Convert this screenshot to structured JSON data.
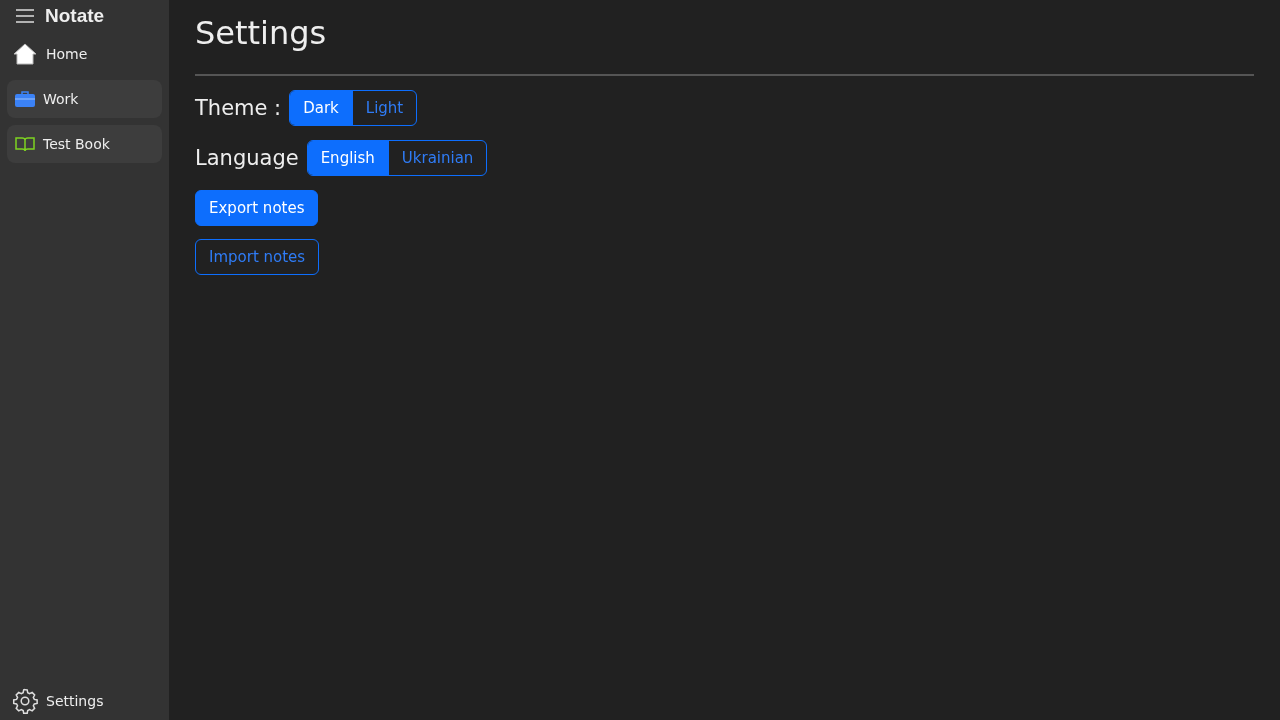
{
  "app": {
    "title": "Notate"
  },
  "sidebar": {
    "items": [
      {
        "label": "Home",
        "kind": "home"
      },
      {
        "label": "Work",
        "kind": "notebook"
      },
      {
        "label": "Test Book",
        "kind": "notebook"
      }
    ],
    "footer": {
      "label": "Settings"
    }
  },
  "page": {
    "title": "Settings",
    "groups": [
      {
        "label": "Theme :",
        "options": [
          {
            "label": "Dark",
            "selected": true
          },
          {
            "label": "Light",
            "selected": false
          }
        ]
      },
      {
        "label": "Language",
        "options": [
          {
            "label": "English",
            "selected": true
          },
          {
            "label": "Ukrainian",
            "selected": false
          }
        ]
      }
    ],
    "buttons": [
      {
        "label": "Export notes",
        "kind": "primary"
      },
      {
        "label": "Import notes",
        "kind": "outline"
      }
    ]
  }
}
